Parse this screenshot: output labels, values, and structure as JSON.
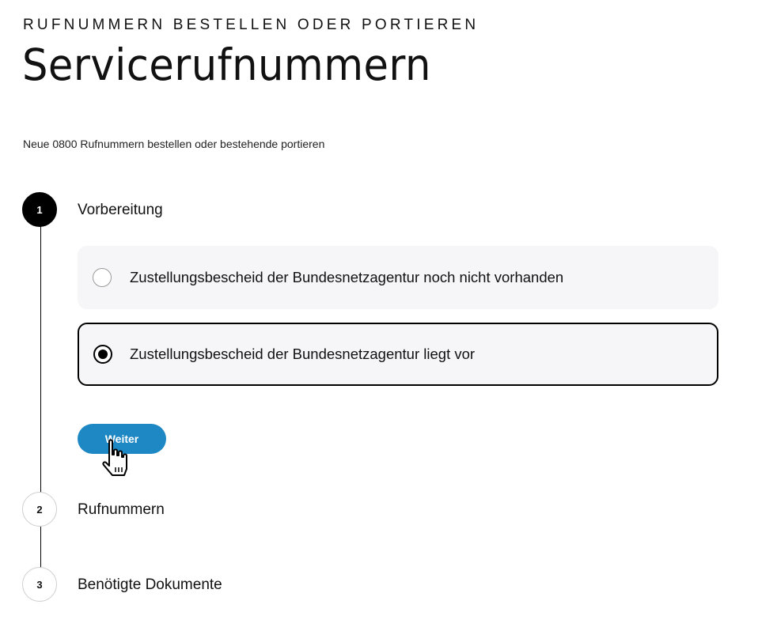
{
  "header": {
    "eyebrow": "RUFNUMMERN BESTELLEN ODER PORTIEREN",
    "title": "Servicerufnummern",
    "subtitle": "Neue 0800 Rufnummern bestellen oder bestehende portieren"
  },
  "steps": [
    {
      "number": "1",
      "label": "Vorbereitung",
      "state": "active"
    },
    {
      "number": "2",
      "label": "Rufnummern",
      "state": "inactive"
    },
    {
      "number": "3",
      "label": "Benötigte Dokumente",
      "state": "inactive"
    }
  ],
  "options": [
    {
      "label": "Zustellungsbescheid der Bundesnetzagentur noch nicht vorhanden",
      "selected": false
    },
    {
      "label": "Zustellungsbescheid der Bundesnetzagentur liegt vor",
      "selected": true
    }
  ],
  "actions": {
    "next_label": "Weiter"
  },
  "colors": {
    "primary_button": "#1e88c4",
    "active_step": "#000000",
    "option_background": "#f6f6f8"
  },
  "cursor": {
    "icon": "hand-pointer-icon"
  }
}
